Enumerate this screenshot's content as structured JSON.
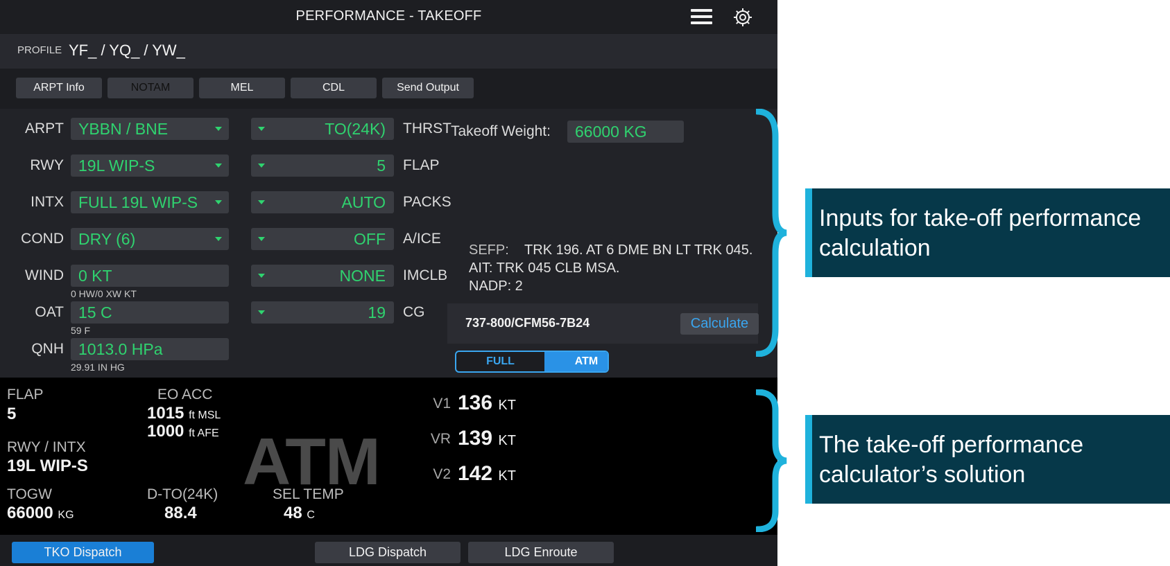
{
  "header": {
    "title": "PERFORMANCE - TAKEOFF",
    "menu_icon": "hamburger-menu-icon",
    "settings_icon": "gear-icon"
  },
  "profile": {
    "label": "PROFILE",
    "value": "YF_ / YQ_ / YW_"
  },
  "toolbar": [
    "ARPT Info",
    "NOTAM",
    "MEL",
    "CDL",
    "Send Output"
  ],
  "inputs": {
    "arpt": {
      "label": "ARPT",
      "value": "YBBN / BNE"
    },
    "rwy": {
      "label": "RWY",
      "value": "19L WIP-S"
    },
    "intx": {
      "label": "INTX",
      "value": "FULL 19L WIP-S"
    },
    "cond": {
      "label": "COND",
      "value": "DRY (6)"
    },
    "wind": {
      "label": "WIND",
      "value": "0 KT",
      "sub": "0 HW/0 XW KT"
    },
    "oat": {
      "label": "OAT",
      "value": "15 C",
      "sub": "59 F"
    },
    "qnh": {
      "label": "QNH",
      "value": "1013.0 HPa",
      "sub": "29.91 IN HG"
    },
    "thrst": {
      "label": "THRST",
      "value": "TO(24K)"
    },
    "flap": {
      "label": "FLAP",
      "value": "5"
    },
    "packs": {
      "label": "PACKS",
      "value": "AUTO"
    },
    "aice": {
      "label": "A/ICE",
      "value": "OFF"
    },
    "imclb": {
      "label": "IMCLB",
      "value": "NONE"
    },
    "cg": {
      "label": "CG",
      "value": "19"
    }
  },
  "takeoff_weight": {
    "label": "Takeoff Weight:",
    "value": "66000 KG"
  },
  "sefp": {
    "key": "SEFP:",
    "line1": "TRK 196. AT 6 DME BN LT TRK 045.",
    "line2": "AIT: TRK 045 CLB MSA.",
    "line3": "NADP: 2"
  },
  "aircraft": {
    "label": "737-800/CFM56-7B24",
    "calculate": "Calculate"
  },
  "mode": {
    "full": "FULL",
    "atm": "ATM",
    "selected": "ATM"
  },
  "results": {
    "flap": {
      "label": "FLAP",
      "value": "5"
    },
    "rwy_intx": {
      "label": "RWY / INTX",
      "value": "19L WIP-S"
    },
    "togw": {
      "label": "TOGW",
      "value": "66000",
      "unit": "KG"
    },
    "eo_acc": {
      "label": "EO ACC",
      "msl_value": "1015",
      "msl_unit": "ft MSL",
      "afe_value": "1000",
      "afe_unit": "ft AFE"
    },
    "d_to": {
      "label": "D-TO(24K)",
      "value": "88.4"
    },
    "sel_temp": {
      "label": "SEL TEMP",
      "value": "48",
      "unit": "C"
    },
    "mode_big": "ATM",
    "v1": {
      "label": "V1",
      "value": "136",
      "unit": "KT"
    },
    "vr": {
      "label": "VR",
      "value": "139",
      "unit": "KT"
    },
    "v2": {
      "label": "V2",
      "value": "142",
      "unit": "KT"
    }
  },
  "bottom_tabs": {
    "tko": "TKO Dispatch",
    "ldg_dispatch": "LDG Dispatch",
    "ldg_enroute": "LDG Enroute",
    "active": "TKO Dispatch"
  },
  "annotations": {
    "inputs_callout": {
      "line1": "Inputs for take-off performance",
      "line2": "calculation"
    },
    "solution_callout": {
      "line1": "The take-off performance",
      "line2": "calculator’s solution"
    }
  },
  "colors": {
    "value_green": "#2fd36f",
    "accent_blue": "#3aa6f0",
    "active_tab_blue": "#1a7fd6",
    "callout_bg": "#063849",
    "brace_cyan": "#1fb2dc"
  }
}
